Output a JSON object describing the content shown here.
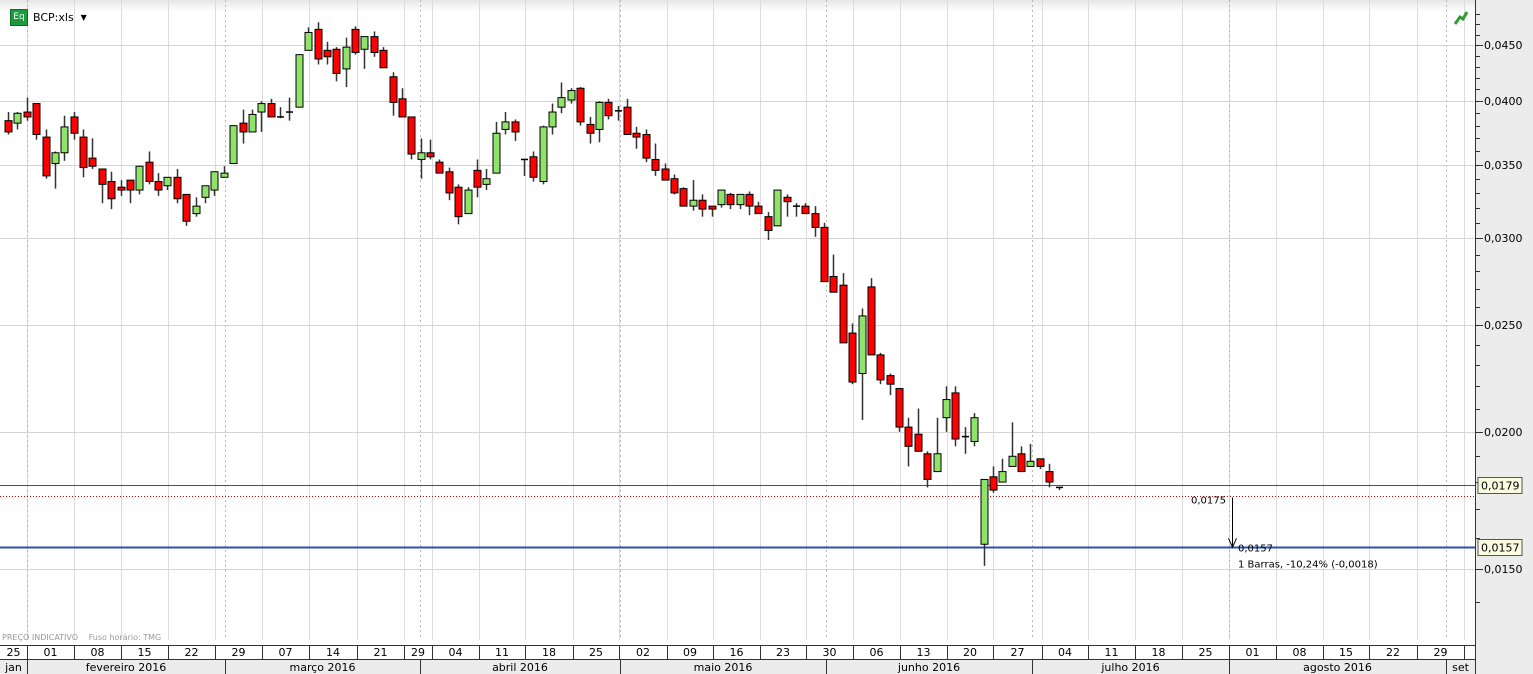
{
  "header": {
    "symbol": "BCP:xls",
    "badge": "Eq",
    "dropdown_icon": "caret-down-icon"
  },
  "footer": {
    "price_note": "PREÇO INDICATIVO",
    "timezone": "Fuso horário: TMG"
  },
  "colors": {
    "up": "#8fe26a",
    "down": "#ff0000",
    "line": "#2d4fae",
    "marker_line": "#cc0000",
    "tag_bg": "#fbfbe0"
  },
  "chart_data": {
    "type": "candlestick",
    "title": "",
    "scale": "log",
    "ylim": [
      0.0138,
      0.048
    ],
    "grid": true,
    "y_ticks": [
      {
        "value": 0.045,
        "label": "0,0450"
      },
      {
        "value": 0.04,
        "label": "0,0400"
      },
      {
        "value": 0.035,
        "label": "0,0350"
      },
      {
        "value": 0.03,
        "label": "0,0300"
      },
      {
        "value": 0.025,
        "label": "0,0250"
      },
      {
        "value": 0.02,
        "label": "0,0200"
      },
      {
        "value": 0.015,
        "label": "0,0150"
      }
    ],
    "week_labels": [
      "25",
      "01",
      "08",
      "15",
      "22",
      "29",
      "07",
      "14",
      "21",
      "29",
      "04",
      "11",
      "18",
      "25",
      "02",
      "09",
      "16",
      "23",
      "30",
      "06",
      "13",
      "20",
      "27",
      "04",
      "11",
      "18",
      "25",
      "01",
      "08",
      "15",
      "22",
      "29",
      ""
    ],
    "month_labels": [
      "jan",
      "fevereiro 2016",
      "março 2016",
      "abril 2016",
      "maio 2016",
      "junho 2016",
      "julho 2016",
      "agosto 2016",
      "set"
    ],
    "candles_fields": [
      "date",
      "open",
      "high",
      "low",
      "close"
    ],
    "candles": [
      [
        "2016-01-27",
        0.0384,
        0.0391,
        0.0373,
        0.0375
      ],
      [
        "2016-01-28",
        0.0382,
        0.0391,
        0.0377,
        0.039
      ],
      [
        "2016-01-29",
        0.0391,
        0.0403,
        0.0384,
        0.0387
      ],
      [
        "2016-02-01",
        0.0398,
        0.0398,
        0.0369,
        0.0373
      ],
      [
        "2016-02-02",
        0.0371,
        0.0377,
        0.034,
        0.0342
      ],
      [
        "2016-02-03",
        0.0351,
        0.036,
        0.0333,
        0.0359
      ],
      [
        "2016-02-04",
        0.0359,
        0.0388,
        0.0353,
        0.0379
      ],
      [
        "2016-02-05",
        0.0387,
        0.0391,
        0.0369,
        0.0374
      ],
      [
        "2016-02-08",
        0.0371,
        0.0377,
        0.0341,
        0.0348
      ],
      [
        "2016-02-09",
        0.0355,
        0.037,
        0.0347,
        0.0349
      ],
      [
        "2016-02-10",
        0.0347,
        0.0347,
        0.0323,
        0.0336
      ],
      [
        "2016-02-11",
        0.0338,
        0.0345,
        0.0319,
        0.0326
      ],
      [
        "2016-02-12",
        0.0334,
        0.0339,
        0.0328,
        0.0332
      ],
      [
        "2016-02-15",
        0.0339,
        0.0339,
        0.0323,
        0.0332
      ],
      [
        "2016-02-16",
        0.0332,
        0.0349,
        0.0329,
        0.0349
      ],
      [
        "2016-02-17",
        0.0352,
        0.036,
        0.0336,
        0.0338
      ],
      [
        "2016-02-18",
        0.0338,
        0.0344,
        0.0328,
        0.0332
      ],
      [
        "2016-02-19",
        0.0335,
        0.0341,
        0.0332,
        0.0341
      ],
      [
        "2016-02-22",
        0.0341,
        0.0347,
        0.0323,
        0.0326
      ],
      [
        "2016-02-23",
        0.0329,
        0.0329,
        0.0308,
        0.0311
      ],
      [
        "2016-02-24",
        0.0316,
        0.0327,
        0.0314,
        0.0321
      ],
      [
        "2016-02-25",
        0.0327,
        0.0335,
        0.0323,
        0.0335
      ],
      [
        "2016-02-26",
        0.0332,
        0.0345,
        0.0328,
        0.0345
      ],
      [
        "2016-02-29",
        0.0341,
        0.0349,
        0.0341,
        0.0344
      ],
      [
        "2016-03-01",
        0.0351,
        0.038,
        0.0351,
        0.038
      ],
      [
        "2016-03-02",
        0.0382,
        0.0393,
        0.0366,
        0.0375
      ],
      [
        "2016-03-03",
        0.0375,
        0.0393,
        0.0375,
        0.0389
      ],
      [
        "2016-03-04",
        0.0391,
        0.04,
        0.0375,
        0.0398
      ],
      [
        "2016-03-07",
        0.0398,
        0.0402,
        0.0387,
        0.0387
      ],
      [
        "2016-03-08",
        0.0387,
        0.0395,
        0.0386,
        0.0387
      ],
      [
        "2016-03-09",
        0.0391,
        0.0403,
        0.0384,
        0.0391
      ],
      [
        "2016-03-10",
        0.0395,
        0.0441,
        0.0395,
        0.0441
      ],
      [
        "2016-03-11",
        0.0445,
        0.0467,
        0.0445,
        0.0462
      ],
      [
        "2016-03-14",
        0.0465,
        0.0472,
        0.0432,
        0.0437
      ],
      [
        "2016-03-15",
        0.0445,
        0.0453,
        0.0432,
        0.0439
      ],
      [
        "2016-03-16",
        0.0446,
        0.0448,
        0.0417,
        0.0424
      ],
      [
        "2016-03-17",
        0.0428,
        0.0457,
        0.0412,
        0.0448
      ],
      [
        "2016-03-18",
        0.0465,
        0.0468,
        0.0441,
        0.0443
      ],
      [
        "2016-03-21",
        0.0446,
        0.0458,
        0.0428,
        0.0458
      ],
      [
        "2016-03-22",
        0.0458,
        0.0463,
        0.0439,
        0.0443
      ],
      [
        "2016-03-23",
        0.0445,
        0.0448,
        0.0429,
        0.0429
      ],
      [
        "2016-03-24",
        0.0421,
        0.0425,
        0.0388,
        0.0399
      ],
      [
        "2016-03-29",
        0.0402,
        0.0411,
        0.0387,
        0.0387
      ],
      [
        "2016-03-30",
        0.0387,
        0.0387,
        0.0354,
        0.0358
      ],
      [
        "2016-03-31",
        0.0354,
        0.037,
        0.034,
        0.0359
      ],
      [
        "2016-04-01",
        0.0359,
        0.0369,
        0.0354,
        0.0356
      ],
      [
        "2016-04-04",
        0.0352,
        0.0354,
        0.0344,
        0.0344
      ],
      [
        "2016-04-05",
        0.0345,
        0.0348,
        0.0325,
        0.033
      ],
      [
        "2016-04-06",
        0.0334,
        0.0336,
        0.0309,
        0.0314
      ],
      [
        "2016-04-07",
        0.0316,
        0.0334,
        0.0316,
        0.0332
      ],
      [
        "2016-04-08",
        0.0346,
        0.0354,
        0.0327,
        0.0334
      ],
      [
        "2016-04-11",
        0.0336,
        0.0347,
        0.0332,
        0.034
      ],
      [
        "2016-04-12",
        0.0344,
        0.0383,
        0.0344,
        0.0374
      ],
      [
        "2016-04-13",
        0.0377,
        0.0391,
        0.0373,
        0.0383
      ],
      [
        "2016-04-14",
        0.0383,
        0.0385,
        0.0368,
        0.0375
      ],
      [
        "2016-04-15",
        0.0354,
        0.0354,
        0.0342,
        0.0354
      ],
      [
        "2016-04-18",
        0.0356,
        0.036,
        0.0338,
        0.0341
      ],
      [
        "2016-04-19",
        0.0338,
        0.038,
        0.0336,
        0.0379
      ],
      [
        "2016-04-20",
        0.0379,
        0.0398,
        0.0373,
        0.0391
      ],
      [
        "2016-04-21",
        0.0395,
        0.0416,
        0.039,
        0.0403
      ],
      [
        "2016-04-22",
        0.0401,
        0.0411,
        0.0398,
        0.0409
      ],
      [
        "2016-04-25",
        0.0411,
        0.0412,
        0.038,
        0.0383
      ],
      [
        "2016-04-26",
        0.0381,
        0.0387,
        0.0366,
        0.0374
      ],
      [
        "2016-04-27",
        0.0377,
        0.04,
        0.0367,
        0.0399
      ],
      [
        "2016-04-28",
        0.0399,
        0.0402,
        0.0385,
        0.0388
      ],
      [
        "2016-04-29",
        0.0391,
        0.0396,
        0.0384,
        0.0392
      ],
      [
        "2016-05-02",
        0.0395,
        0.0402,
        0.0373,
        0.0373
      ],
      [
        "2016-05-03",
        0.0374,
        0.0379,
        0.0362,
        0.0371
      ],
      [
        "2016-05-04",
        0.0373,
        0.0377,
        0.0352,
        0.0355
      ],
      [
        "2016-05-05",
        0.0354,
        0.0366,
        0.0342,
        0.0346
      ],
      [
        "2016-05-06",
        0.0347,
        0.0351,
        0.0339,
        0.0339
      ],
      [
        "2016-05-09",
        0.034,
        0.0343,
        0.0329,
        0.033
      ],
      [
        "2016-05-10",
        0.0333,
        0.0334,
        0.0321,
        0.0321
      ],
      [
        "2016-05-11",
        0.0321,
        0.0339,
        0.0318,
        0.0325
      ],
      [
        "2016-05-12",
        0.0325,
        0.0329,
        0.0314,
        0.0319
      ],
      [
        "2016-05-13",
        0.0321,
        0.0321,
        0.0314,
        0.0319
      ],
      [
        "2016-05-16",
        0.0322,
        0.0332,
        0.032,
        0.0332
      ],
      [
        "2016-05-17",
        0.0329,
        0.033,
        0.0319,
        0.0322
      ],
      [
        "2016-05-18",
        0.0322,
        0.0329,
        0.0319,
        0.0329
      ],
      [
        "2016-05-19",
        0.0329,
        0.0331,
        0.0315,
        0.0321
      ],
      [
        "2016-05-20",
        0.0321,
        0.0324,
        0.0316,
        0.0316
      ],
      [
        "2016-05-23",
        0.0314,
        0.0317,
        0.0299,
        0.0305
      ],
      [
        "2016-05-24",
        0.0308,
        0.0332,
        0.0308,
        0.0332
      ],
      [
        "2016-05-25",
        0.0327,
        0.0329,
        0.0314,
        0.0324
      ],
      [
        "2016-05-26",
        0.0321,
        0.0323,
        0.0314,
        0.0321
      ],
      [
        "2016-05-27",
        0.0321,
        0.0323,
        0.0316,
        0.0316
      ],
      [
        "2016-05-30",
        0.0316,
        0.0321,
        0.0301,
        0.0307
      ],
      [
        "2016-05-31",
        0.0307,
        0.031,
        0.0274,
        0.0274
      ],
      [
        "2016-06-01",
        0.0277,
        0.029,
        0.0268,
        0.0268
      ],
      [
        "2016-06-02",
        0.0272,
        0.0279,
        0.0241,
        0.0241
      ],
      [
        "2016-06-03",
        0.0246,
        0.0251,
        0.0221,
        0.0222
      ],
      [
        "2016-06-06",
        0.0226,
        0.0259,
        0.0205,
        0.0255
      ],
      [
        "2016-06-07",
        0.0271,
        0.0276,
        0.0235,
        0.0235
      ],
      [
        "2016-06-08",
        0.0235,
        0.0236,
        0.0221,
        0.0223
      ],
      [
        "2016-06-09",
        0.0225,
        0.0226,
        0.0216,
        0.0221
      ],
      [
        "2016-06-10",
        0.0219,
        0.0219,
        0.02,
        0.0202
      ],
      [
        "2016-06-13",
        0.0202,
        0.0206,
        0.0186,
        0.0194
      ],
      [
        "2016-06-14",
        0.0199,
        0.021,
        0.0192,
        0.0192
      ],
      [
        "2016-06-15",
        0.0191,
        0.0192,
        0.0178,
        0.0181
      ],
      [
        "2016-06-16",
        0.0184,
        0.0206,
        0.0184,
        0.0191
      ],
      [
        "2016-06-17",
        0.0206,
        0.022,
        0.02,
        0.0214
      ],
      [
        "2016-06-20",
        0.0217,
        0.022,
        0.0194,
        0.0197
      ],
      [
        "2016-06-21",
        0.0198,
        0.0202,
        0.0191,
        0.0198
      ],
      [
        "2016-06-22",
        0.0196,
        0.0208,
        0.0194,
        0.0206
      ],
      [
        "2016-06-23",
        0.0158,
        0.0181,
        0.0151,
        0.0181
      ],
      [
        "2016-06-24",
        0.0182,
        0.0186,
        0.0176,
        0.0177
      ],
      [
        "2016-06-27",
        0.018,
        0.0189,
        0.018,
        0.0184
      ],
      [
        "2016-06-28",
        0.0186,
        0.0204,
        0.0186,
        0.019
      ],
      [
        "2016-06-29",
        0.0191,
        0.0194,
        0.0184,
        0.0184
      ],
      [
        "2016-06-30",
        0.0186,
        0.0195,
        0.0186,
        0.0188
      ],
      [
        "2016-07-01",
        0.0189,
        0.0189,
        0.0185,
        0.0186
      ],
      [
        "2016-07-04",
        0.0184,
        0.0187,
        0.0178,
        0.018
      ],
      [
        "2016-07-05",
        0.0178,
        0.0178,
        0.0177,
        0.0178
      ]
    ],
    "horizontal_lines": [
      {
        "value": 0.0179,
        "label": "0,0179",
        "style": "thin"
      },
      {
        "value": 0.0157,
        "label": "0,0157",
        "style": "thick"
      }
    ],
    "marker_line": {
      "value": 0.0175
    },
    "measure": {
      "from": 0.0175,
      "to": 0.0157,
      "from_label": "0,0175",
      "to_label": "0,0157",
      "summary": "1 Barras, -10,24% (-0,0018)"
    }
  }
}
